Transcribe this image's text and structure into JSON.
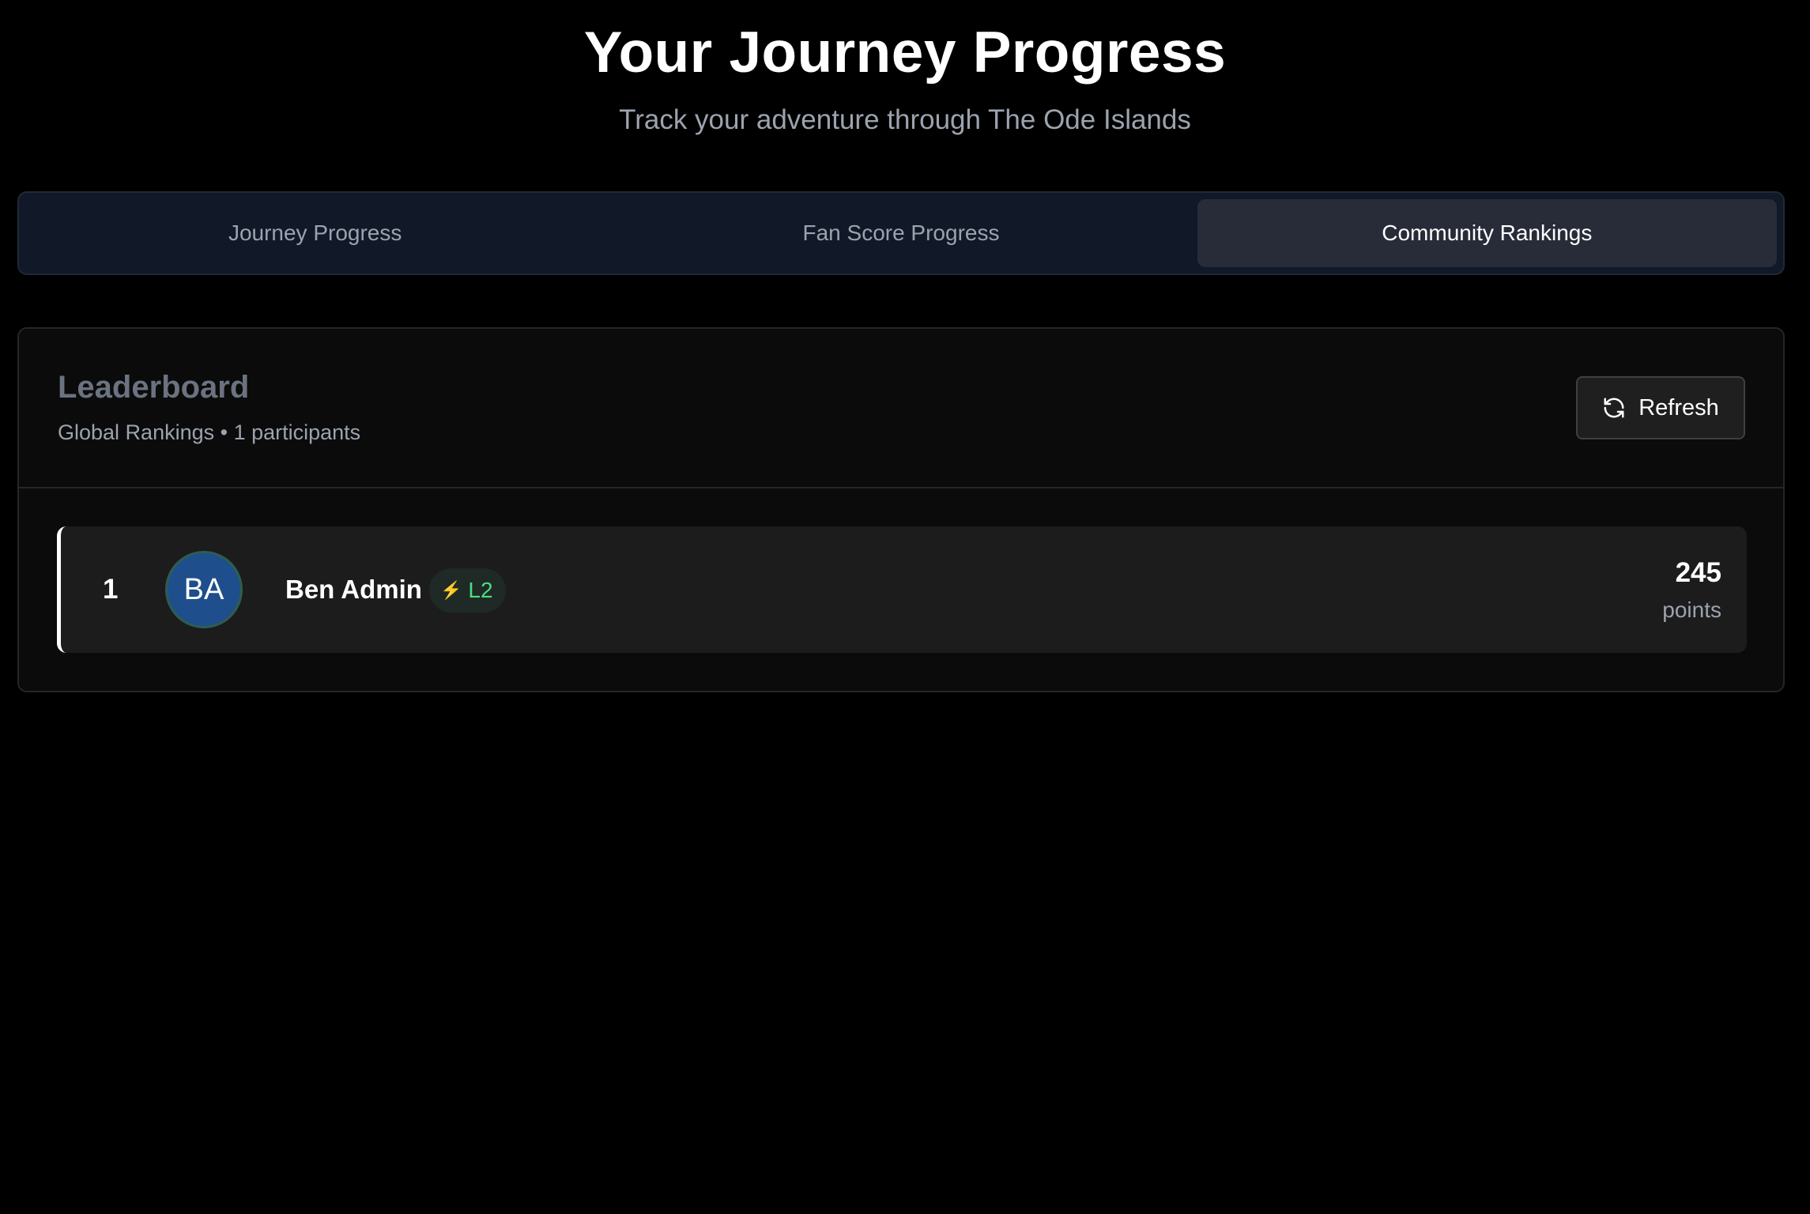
{
  "header": {
    "title": "Your Journey Progress",
    "subtitle": "Track your adventure through The Ode Islands"
  },
  "tabs": [
    {
      "label": "Journey Progress",
      "active": false
    },
    {
      "label": "Fan Score Progress",
      "active": false
    },
    {
      "label": "Community Rankings",
      "active": true
    }
  ],
  "leaderboard": {
    "title": "Leaderboard",
    "subtitle": "Global Rankings • 1 participants",
    "refresh_label": "Refresh",
    "refresh_icon": "refresh-icon",
    "entries": [
      {
        "rank": "1",
        "initials": "BA",
        "name": "Ben Admin",
        "level_icon": "lightning-bolt-icon",
        "level": "L2",
        "points": "245",
        "points_label": "points"
      }
    ]
  },
  "colors": {
    "background": "#000000",
    "tab_bar": "#111827",
    "active_tab": "#272c38",
    "card": "#0b0b0b",
    "row": "#1c1c1c",
    "avatar": "#1e4e8c",
    "level_text": "#4ade80",
    "bolt": "#facc15"
  }
}
